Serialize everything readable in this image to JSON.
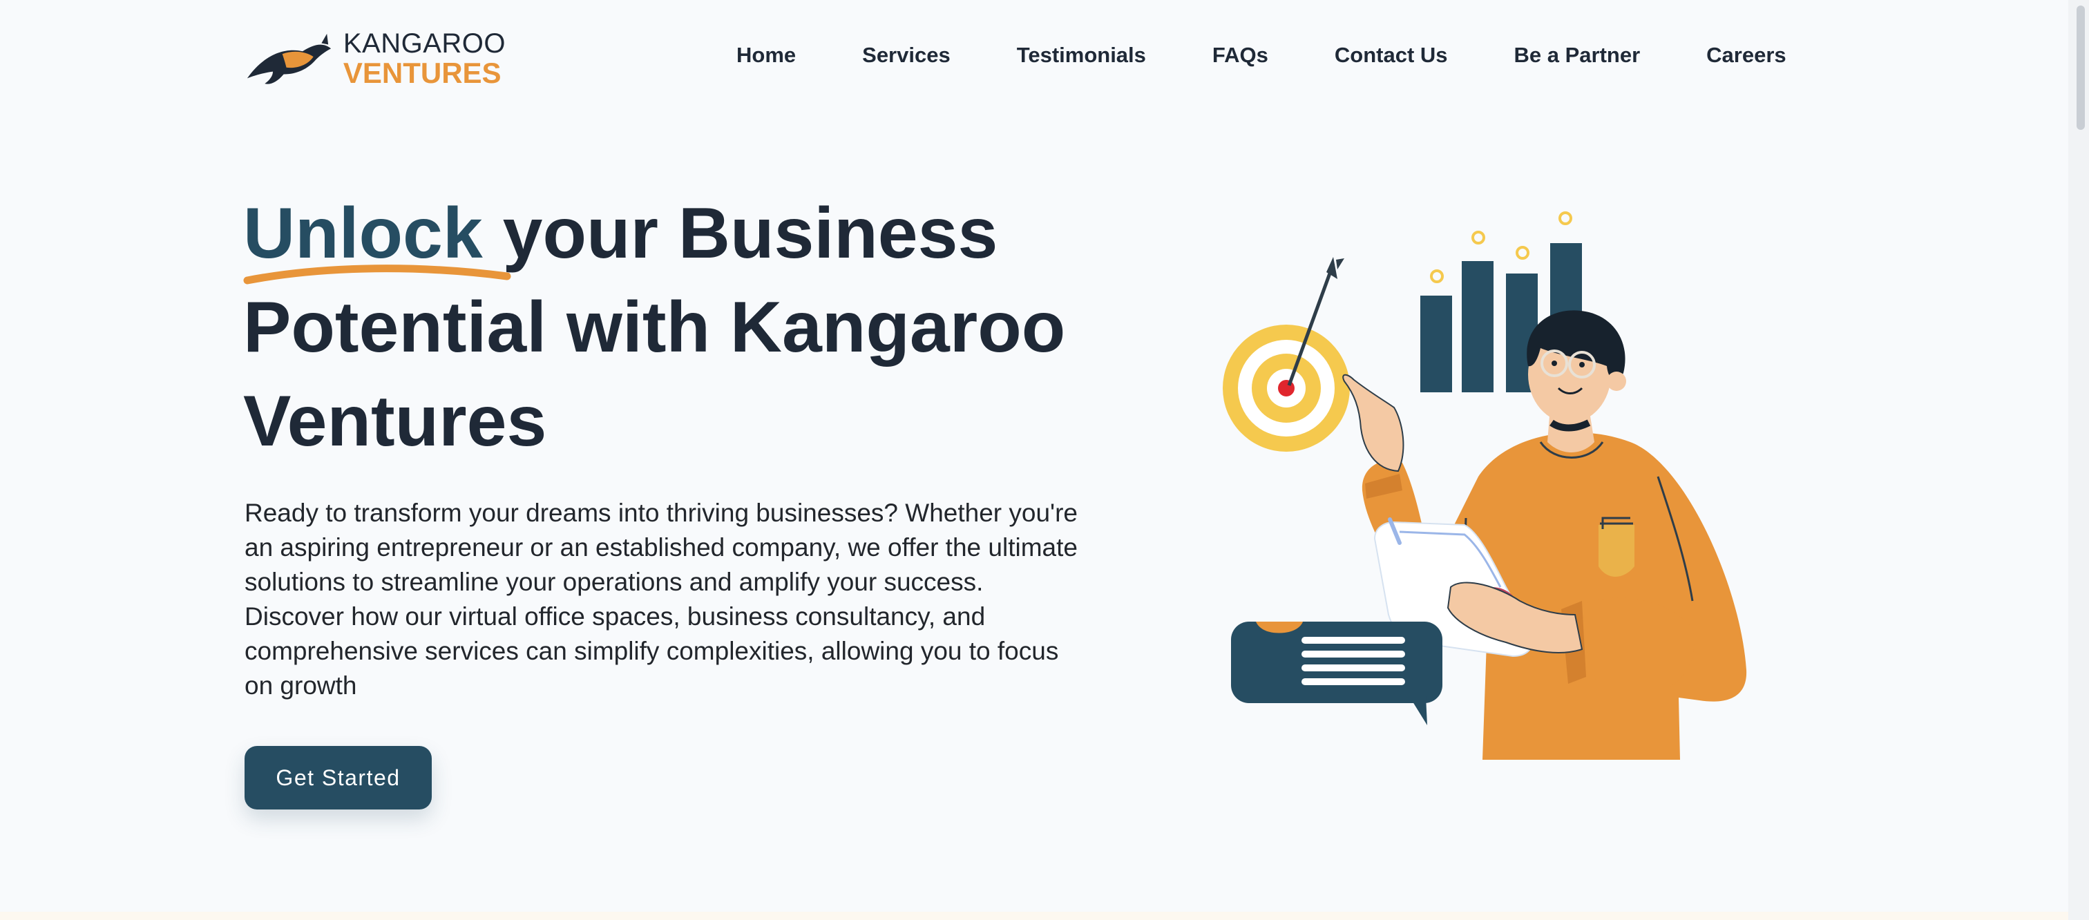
{
  "header": {
    "logo": {
      "line1": "KANGAROO",
      "line2": "VENTURES"
    },
    "nav": [
      {
        "label": "Home"
      },
      {
        "label": "Services"
      },
      {
        "label": "Testimonials"
      },
      {
        "label": "FAQs"
      },
      {
        "label": "Contact Us"
      },
      {
        "label": "Be a Partner"
      },
      {
        "label": "Careers"
      }
    ]
  },
  "hero": {
    "title_accent": "Unlock",
    "title_line1_rest": " your Business",
    "title_line2": "Potential with Kangaroo",
    "title_line3": "Ventures",
    "description": "Ready to transform your dreams into thriving businesses? Whether you're an aspiring entrepreneur or an established company, we offer the ultimate solutions to streamline your operations and amplify your success. Discover how our virtual office spaces, business consultancy, and comprehensive services can simplify complexities, allowing you to focus on growth",
    "cta_label": "Get Started"
  },
  "colors": {
    "accent_orange": "#e8953a",
    "brand_navy": "#264d62",
    "background": "#f8fafc",
    "target_yellow": "#f5c94e"
  },
  "icons": [
    "kangaroo-logo-icon",
    "target-icon",
    "arrow-icon",
    "bar-chart-icon",
    "chat-bubble-icon",
    "person-illustration"
  ]
}
